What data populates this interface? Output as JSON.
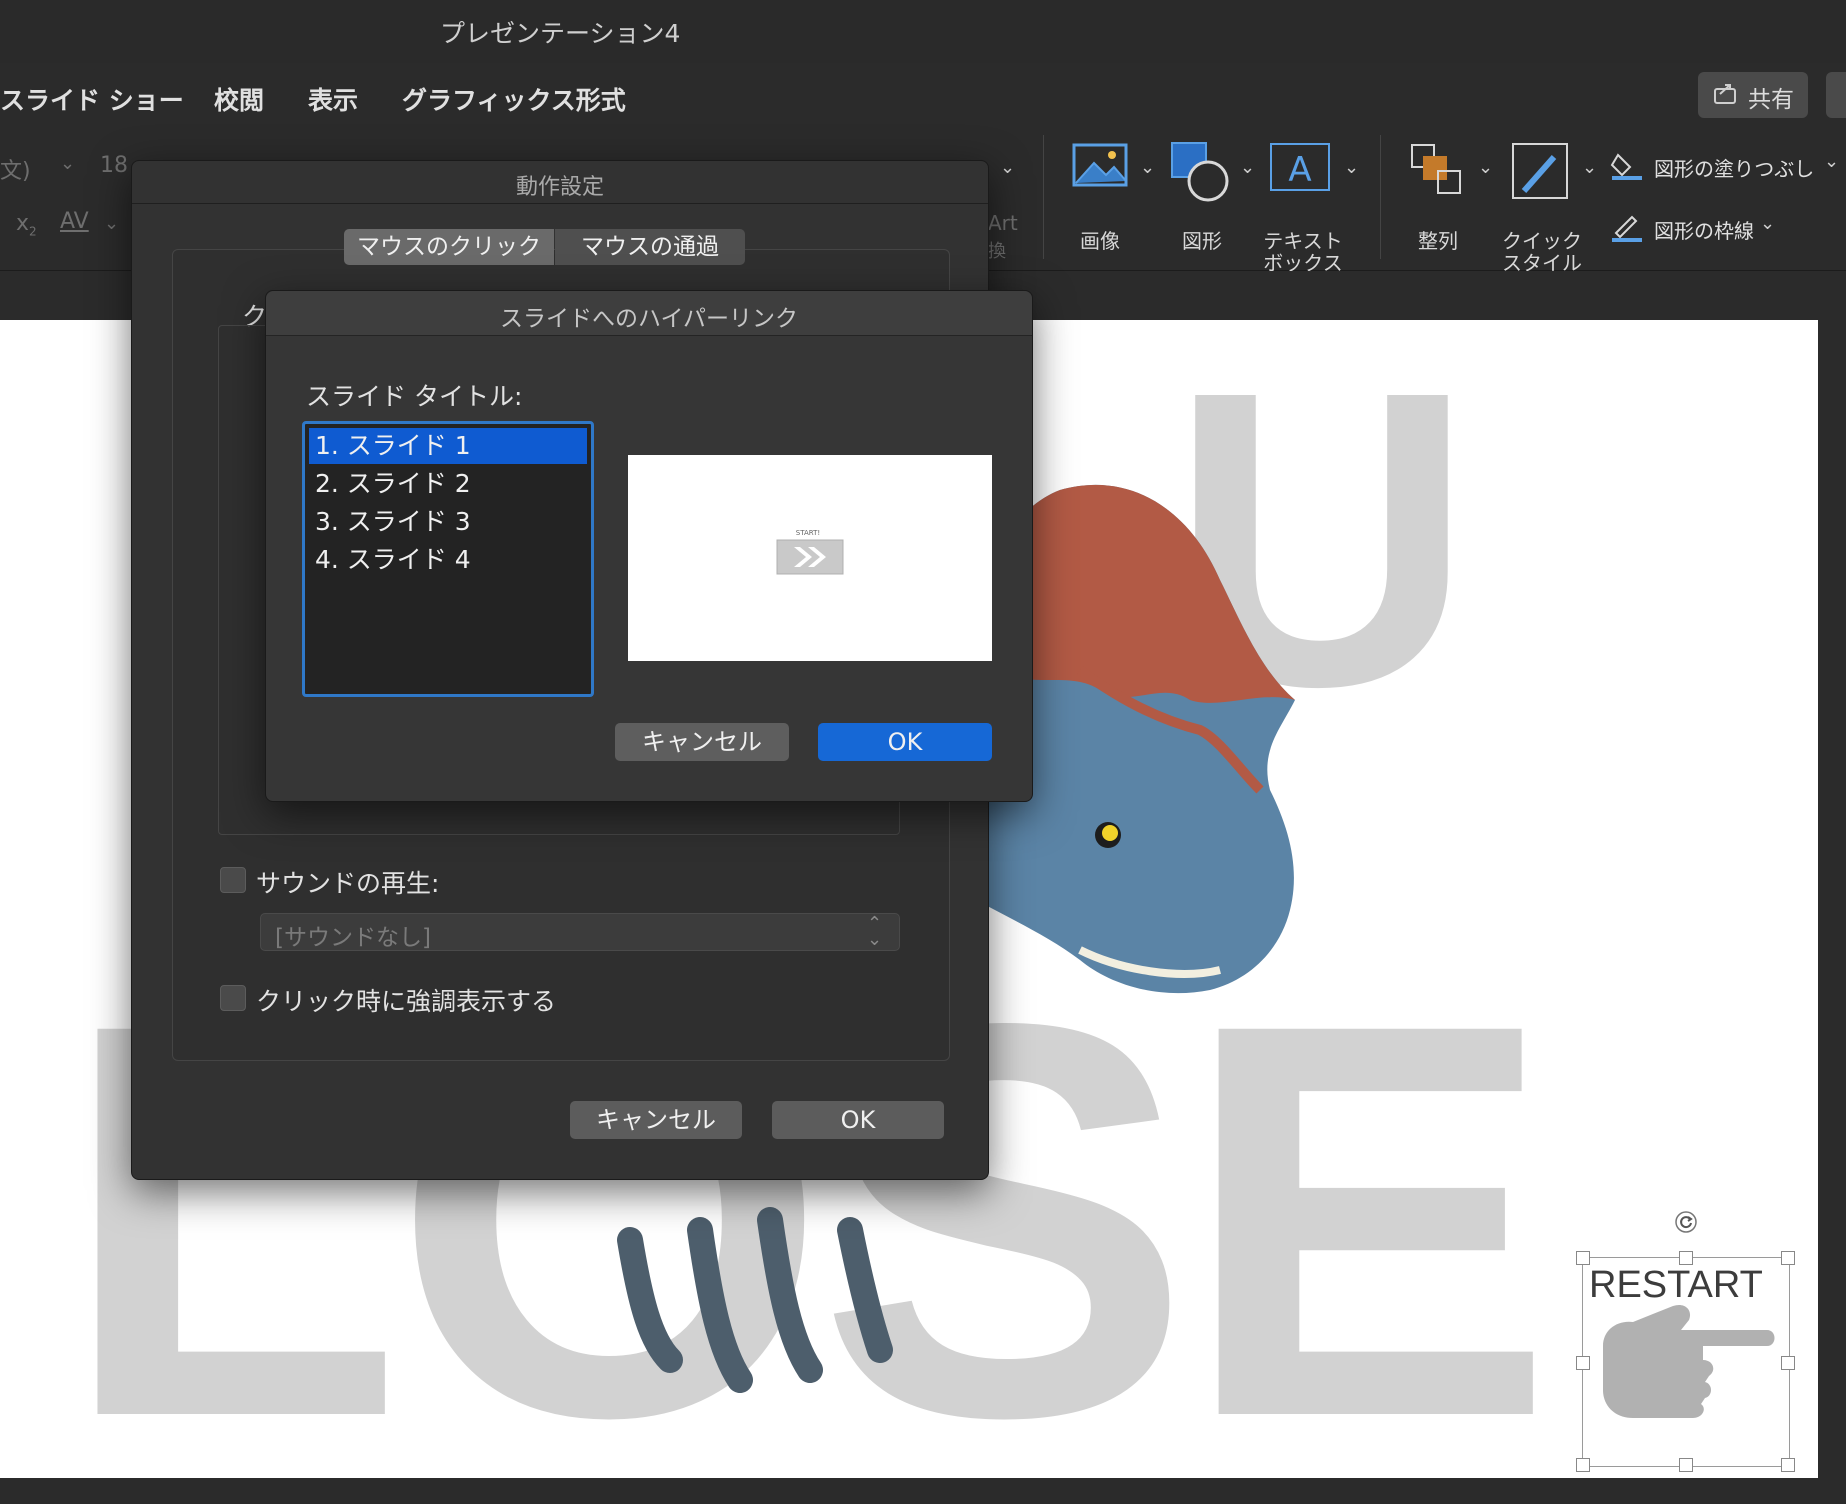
{
  "window": {
    "title": "プレゼンテーション4"
  },
  "tabs": [
    "スライド ショー",
    "校閲",
    "表示",
    "グラフィックス形式"
  ],
  "share": {
    "label": "共有"
  },
  "ribbon": {
    "font_name_fragment": "文)",
    "font_size": "18",
    "art_fragment": "Art",
    "art_fragment2": "換",
    "image_label": "画像",
    "shape_label": "図形",
    "textbox_label_1": "テキスト",
    "textbox_label_2": "ボックス",
    "arrange_label": "整列",
    "quickstyle_label_1": "クイック",
    "quickstyle_label_2": "スタイル",
    "shape_fill_label": "図形の塗りつぶし",
    "shape_outline_label": "図形の枠線"
  },
  "slide": {
    "bg_letters_top": "U",
    "bg_letters_bottom": "LOSE",
    "restart_text": "RESTART"
  },
  "action_dialog": {
    "title": "動作設定",
    "tab_click": "マウスのクリック",
    "tab_hover": "マウスの通過",
    "partial_label": "ク",
    "play_sound_label": "サウンドの再生:",
    "sound_select_value": "[サウンドなし]",
    "highlight_label": "クリック時に強調表示する",
    "cancel_label": "キャンセル",
    "ok_label": "OK"
  },
  "hyperlink_dialog": {
    "title": "スライドへのハイパーリンク",
    "list_label": "スライド タイトル:",
    "slides": [
      "1. スライド 1",
      "2. スライド 2",
      "3. スライド 3",
      "4. スライド 4"
    ],
    "selected_index": 0,
    "preview_text": "START!",
    "cancel_label": "キャンセル",
    "ok_label": "OK"
  },
  "colors": {
    "accent": "#1668d6",
    "list_selection": "#0f5bd1"
  }
}
